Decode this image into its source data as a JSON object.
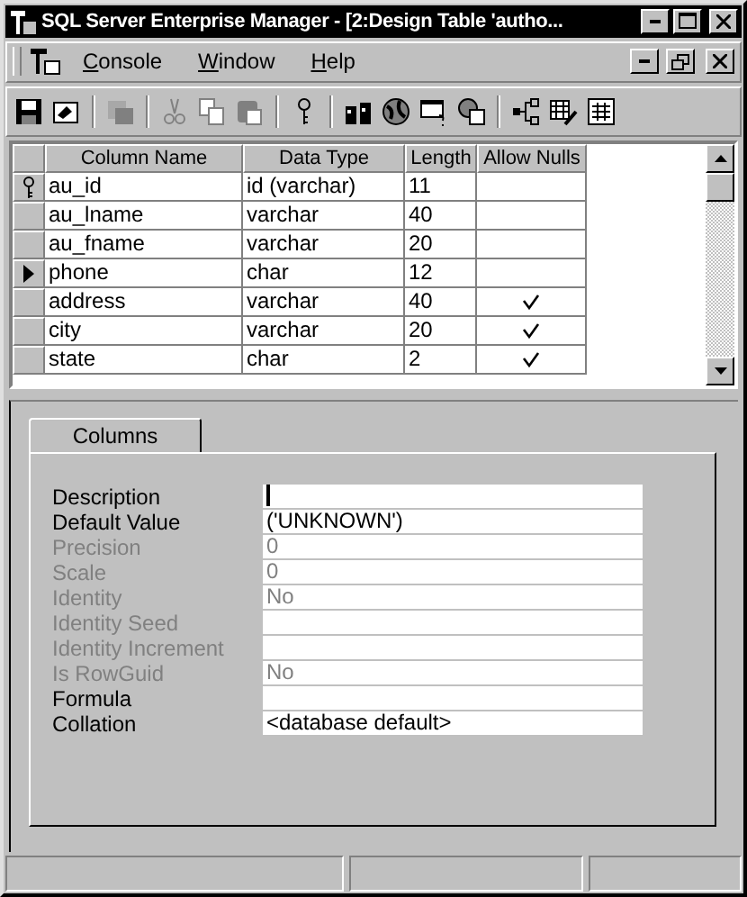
{
  "window": {
    "title": "SQL Server Enterprise Manager - [2:Design Table 'autho..."
  },
  "menu": [
    {
      "label": "Console"
    },
    {
      "label": "Window"
    },
    {
      "label": "Help"
    }
  ],
  "toolbar": [
    {
      "kind": "save",
      "disabled": false
    },
    {
      "kind": "properties",
      "disabled": false
    },
    {
      "kind": "sep"
    },
    {
      "kind": "script",
      "disabled": true
    },
    {
      "kind": "sep"
    },
    {
      "kind": "cut",
      "disabled": true
    },
    {
      "kind": "copy",
      "disabled": true
    },
    {
      "kind": "paste",
      "disabled": true
    },
    {
      "kind": "sep"
    },
    {
      "kind": "key",
      "disabled": false
    },
    {
      "kind": "sep"
    },
    {
      "kind": "indexes",
      "disabled": false
    },
    {
      "kind": "globe",
      "disabled": false
    },
    {
      "kind": "query",
      "disabled": false
    },
    {
      "kind": "triggers",
      "disabled": false
    },
    {
      "kind": "sep"
    },
    {
      "kind": "diagram",
      "disabled": false
    },
    {
      "kind": "edit",
      "disabled": false
    },
    {
      "kind": "grid",
      "disabled": false
    }
  ],
  "table": {
    "columns": [
      "Column Name",
      "Data Type",
      "Length",
      "Allow Nulls"
    ],
    "rows": [
      {
        "name": "au_id",
        "type": "id (varchar)",
        "length": "11",
        "allow_nulls": false,
        "primary_key": true,
        "selected": false
      },
      {
        "name": "au_lname",
        "type": "varchar",
        "length": "40",
        "allow_nulls": false,
        "primary_key": false,
        "selected": false
      },
      {
        "name": "au_fname",
        "type": "varchar",
        "length": "20",
        "allow_nulls": false,
        "primary_key": false,
        "selected": false
      },
      {
        "name": "phone",
        "type": "char",
        "length": "12",
        "allow_nulls": false,
        "primary_key": false,
        "selected": true
      },
      {
        "name": "address",
        "type": "varchar",
        "length": "40",
        "allow_nulls": true,
        "primary_key": false,
        "selected": false
      },
      {
        "name": "city",
        "type": "varchar",
        "length": "20",
        "allow_nulls": true,
        "primary_key": false,
        "selected": false
      },
      {
        "name": "state",
        "type": "char",
        "length": "2",
        "allow_nulls": true,
        "primary_key": false,
        "selected": false
      }
    ]
  },
  "tabs": [
    {
      "label": "Columns",
      "selected": true
    }
  ],
  "properties": [
    {
      "label": "Description",
      "disabled": false,
      "focused": true
    },
    {
      "label": "Default Value",
      "value": "('UNKNOWN')",
      "disabled": false,
      "focused": false
    },
    {
      "label": "Precision",
      "value": "0",
      "disabled": true,
      "focused": false
    },
    {
      "label": "Scale",
      "value": "0",
      "disabled": true,
      "focused": false
    },
    {
      "label": "Identity",
      "value": "No",
      "disabled": true,
      "focused": false
    },
    {
      "label": "Identity Seed",
      "disabled": true,
      "focused": false
    },
    {
      "label": "Identity Increment",
      "disabled": true,
      "focused": false
    },
    {
      "label": "Is RowGuid",
      "value": "No",
      "disabled": true,
      "focused": false
    },
    {
      "label": "Formula",
      "disabled": false,
      "focused": false
    },
    {
      "label": "Collation",
      "value": "<database default>",
      "disabled": false,
      "focused": false
    }
  ]
}
